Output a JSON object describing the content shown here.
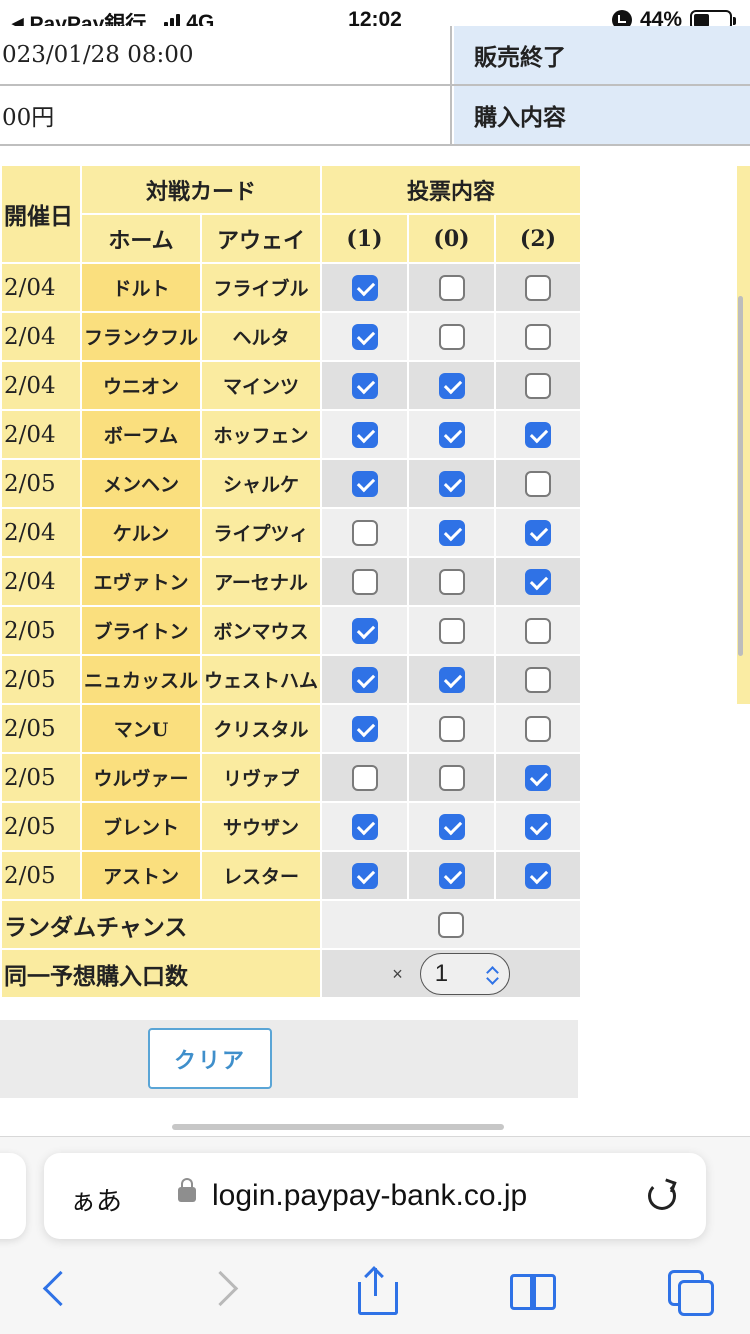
{
  "status_bar": {
    "carrier": "PayPay銀行",
    "network": "4G",
    "time": "12:02",
    "battery": "44%",
    "battery_level": 0.44
  },
  "info": [
    {
      "value": "023/01/28 08:00",
      "label": "販売終了"
    },
    {
      "value": "00円",
      "label": "購入内容"
    }
  ],
  "table": {
    "header_date": "開催日",
    "header_match": "対戦カード",
    "header_vote": "投票内容",
    "header_home": "ホーム",
    "header_away": "アウェイ",
    "header_options": [
      "(1)",
      "(0)",
      "(2)"
    ],
    "rows": [
      {
        "date": "2/04",
        "home": "ドルト",
        "away": "フライブル",
        "picks": [
          true,
          false,
          false
        ]
      },
      {
        "date": "2/04",
        "home": "フランクフル",
        "away": "ヘルタ",
        "picks": [
          true,
          false,
          false
        ]
      },
      {
        "date": "2/04",
        "home": "ウニオン",
        "away": "マインツ",
        "picks": [
          true,
          true,
          false
        ]
      },
      {
        "date": "2/04",
        "home": "ボーフム",
        "away": "ホッフェン",
        "picks": [
          true,
          true,
          true
        ]
      },
      {
        "date": "2/05",
        "home": "メンヘン",
        "away": "シャルケ",
        "picks": [
          true,
          true,
          false
        ]
      },
      {
        "date": "2/04",
        "home": "ケルン",
        "away": "ライプツィ",
        "picks": [
          false,
          true,
          true
        ]
      },
      {
        "date": "2/04",
        "home": "エヴァトン",
        "away": "アーセナル",
        "picks": [
          false,
          false,
          true
        ]
      },
      {
        "date": "2/05",
        "home": "ブライトン",
        "away": "ボンマウス",
        "picks": [
          true,
          false,
          false
        ]
      },
      {
        "date": "2/05",
        "home": "ニュカッスル",
        "away": "ウェストハム",
        "picks": [
          true,
          true,
          false
        ]
      },
      {
        "date": "2/05",
        "home": "マンU",
        "away": "クリスタル",
        "picks": [
          true,
          false,
          false
        ]
      },
      {
        "date": "2/05",
        "home": "ウルヴァー",
        "away": "リヴァプ",
        "picks": [
          false,
          false,
          true
        ]
      },
      {
        "date": "2/05",
        "home": "ブレント",
        "away": "サウザン",
        "picks": [
          true,
          true,
          true
        ]
      },
      {
        "date": "2/05",
        "home": "アストン",
        "away": "レスター",
        "picks": [
          true,
          true,
          true
        ]
      }
    ],
    "random_chance_label": "ランダムチャンス",
    "random_chance_checked": false,
    "same_purchase_label": "同一予想購入口数",
    "multiplier": "×",
    "quantity": "1"
  },
  "clear_button": "クリア",
  "browser": {
    "aa": "ぁあ",
    "url": "login.paypay-bank.co.jp"
  },
  "colors": {
    "accent": "#2f72e6",
    "header_yellow": "#faeca3",
    "home_yellow": "#fadf7e",
    "label_blue": "#deeaf8"
  }
}
